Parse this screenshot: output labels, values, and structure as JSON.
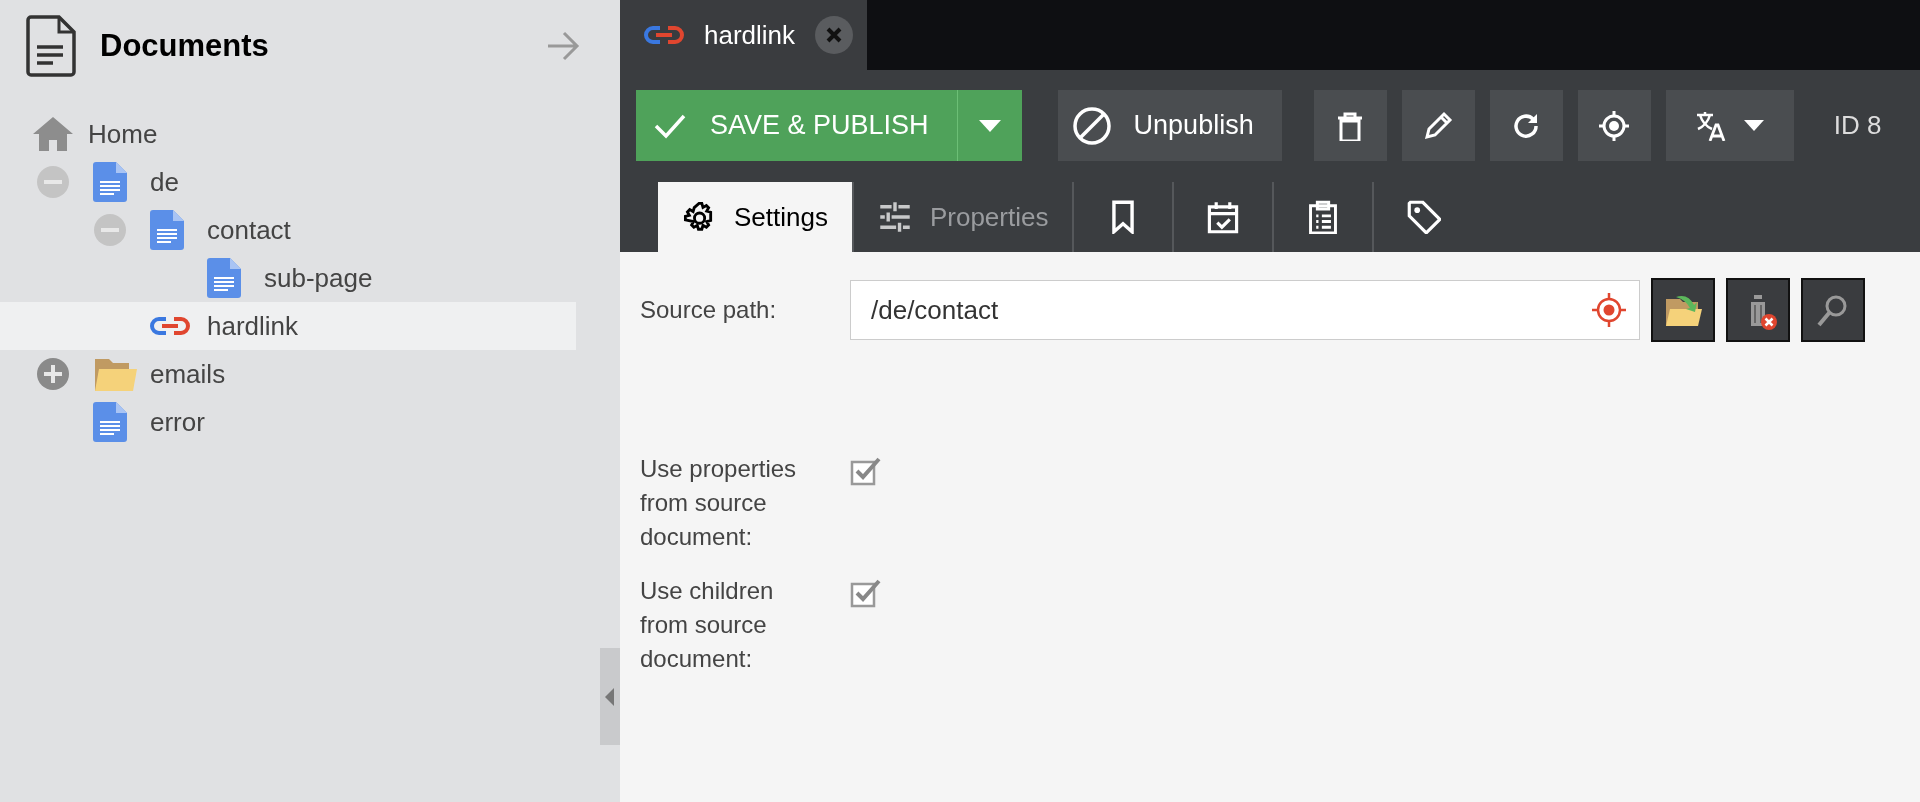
{
  "sidebar": {
    "title": "Documents",
    "tree": {
      "label": "Home",
      "kind": "home",
      "selected": false,
      "children": [
        {
          "label": "de",
          "kind": "page",
          "expanded": true,
          "selected": false,
          "children": [
            {
              "label": "contact",
              "kind": "page",
              "expanded": true,
              "selected": false,
              "children": [
                {
                  "label": "sub-page",
                  "kind": "page",
                  "selected": false
                }
              ]
            },
            {
              "label": "hardlink",
              "kind": "link",
              "selected": true
            }
          ]
        },
        {
          "label": "emails",
          "kind": "folder",
          "expanded": false,
          "selected": false
        },
        {
          "label": "error",
          "kind": "page",
          "selected": false
        }
      ]
    }
  },
  "editor": {
    "tabs": [
      {
        "label": "hardlink",
        "kind": "link",
        "selected": true
      }
    ],
    "toolbar": {
      "save": "SAVE & PUBLISH",
      "unpublish": "Unpublish",
      "tools": [
        {
          "kind": "delete"
        },
        {
          "kind": "edit"
        },
        {
          "kind": "reload"
        },
        {
          "kind": "locate"
        },
        {
          "kind": "translate"
        }
      ],
      "id": "ID 8"
    },
    "subtabs": [
      {
        "kind": "gear",
        "label": "Settings",
        "selected": true
      },
      {
        "kind": "sliders",
        "label": "Properties",
        "selected": false
      },
      {
        "kind": "bookmark",
        "selected": false
      },
      {
        "kind": "calendar",
        "selected": false
      },
      {
        "kind": "clipboard",
        "selected": false
      },
      {
        "kind": "tag",
        "selected": false
      }
    ],
    "form": {
      "source_path": {
        "label": "Source path:",
        "value": "/de/contact"
      },
      "options": [
        {
          "label": "Use properties from source document:",
          "checked": true
        },
        {
          "label": "Use children from source document:",
          "checked": true
        }
      ]
    }
  }
}
